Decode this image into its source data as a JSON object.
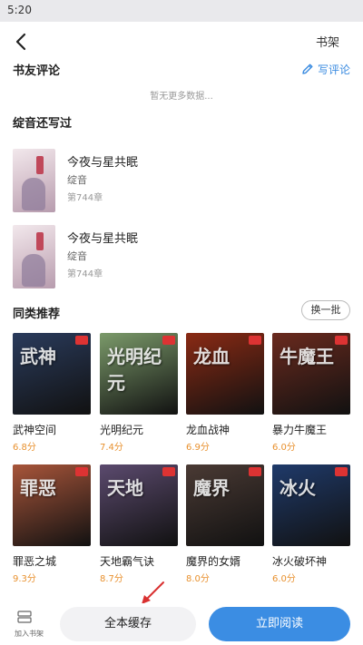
{
  "status_bar": {
    "time": "5:20"
  },
  "nav": {
    "back_icon": "chevron-left-icon",
    "bookshelf_label": "书架"
  },
  "reviews": {
    "title": "书友评论",
    "write_label": "写评论",
    "write_icon": "pencil-icon",
    "empty_text": "暂无更多数据..."
  },
  "author_works": {
    "title": "绽音还写过",
    "items": [
      {
        "title": "今夜与星共眠",
        "author": "绽音",
        "chapter": "第744章"
      },
      {
        "title": "今夜与星共眠",
        "author": "绽音",
        "chapter": "第744章"
      }
    ]
  },
  "recommend": {
    "title": "同类推荐",
    "batch_label": "换一批",
    "books": [
      {
        "title": "武神空间",
        "score": "6.8分",
        "cover_text": "武神",
        "color": "#2a3b5c"
      },
      {
        "title": "光明纪元",
        "score": "7.4分",
        "cover_text": "光明纪元",
        "color": "#7b9a6a"
      },
      {
        "title": "龙血战神",
        "score": "6.9分",
        "cover_text": "龙血",
        "color": "#8a2a14"
      },
      {
        "title": "暴力牛魔王",
        "score": "6.0分",
        "cover_text": "牛魔王",
        "color": "#6a2a1e"
      },
      {
        "title": "罪恶之城",
        "score": "9.3分",
        "cover_text": "罪恶",
        "color": "#a8553a"
      },
      {
        "title": "天地霸气诀",
        "score": "8.7分",
        "cover_text": "天地",
        "color": "#5b4a6e"
      },
      {
        "title": "魔界的女婿",
        "score": "8.0分",
        "cover_text": "魔界",
        "color": "#4a3a34"
      },
      {
        "title": "冰火破坏神",
        "score": "6.0分",
        "cover_text": "冰火",
        "color": "#1f3a6a"
      }
    ]
  },
  "bottom": {
    "add_shelf_label": "加入书架",
    "cache_label": "全本缓存",
    "read_label": "立即阅读"
  },
  "colors": {
    "accent": "#3b8de3",
    "score": "#e8912f",
    "annotation_arrow": "#d93030"
  }
}
